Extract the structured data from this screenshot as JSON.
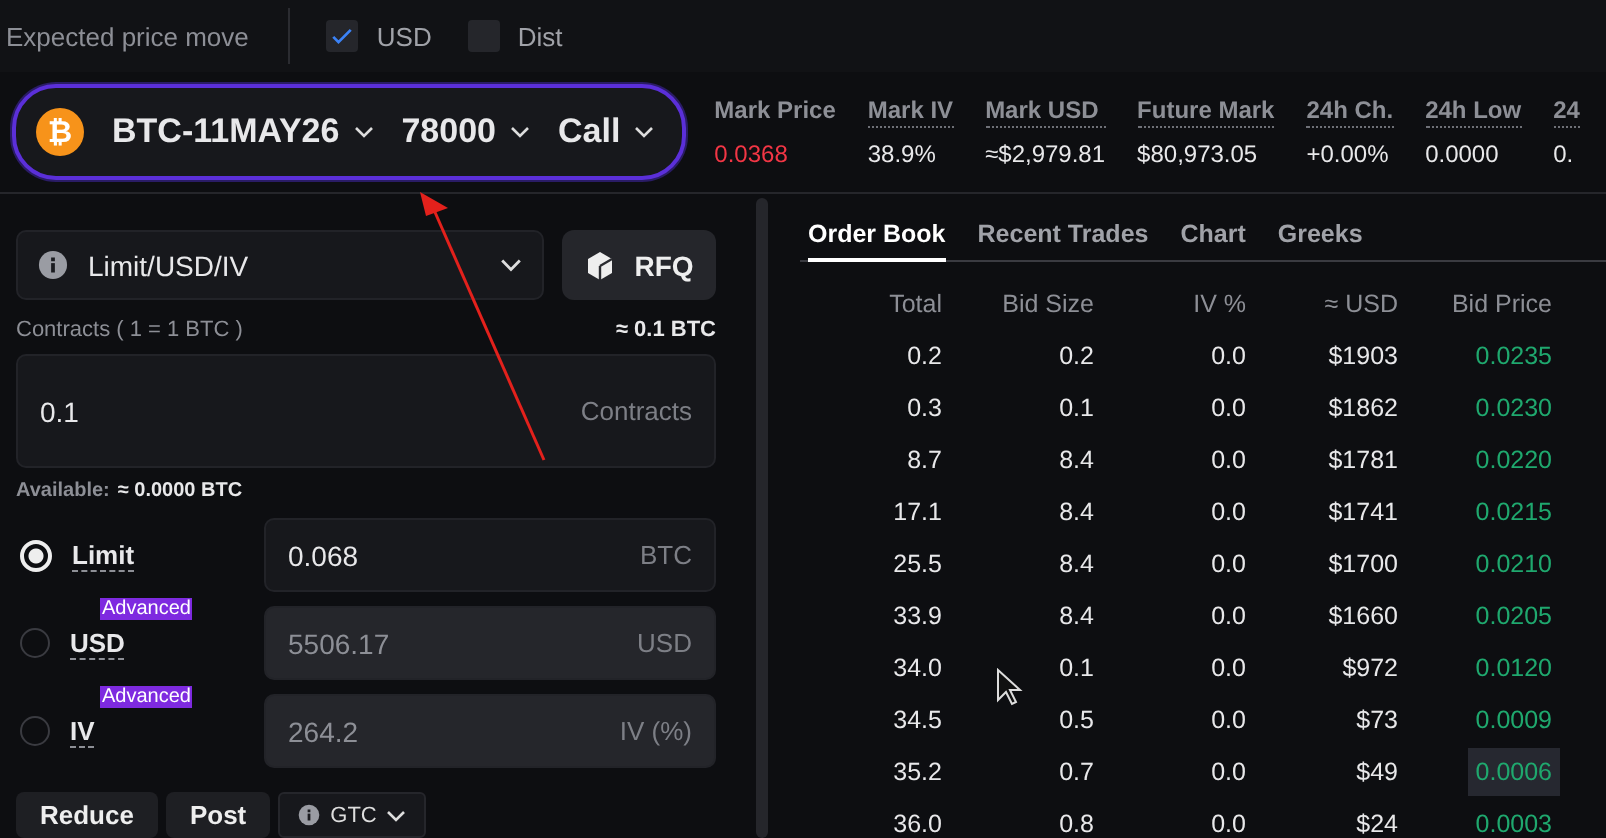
{
  "top_bar": {
    "label": "Expected price move",
    "checkboxes": [
      {
        "label": "USD",
        "checked": true
      },
      {
        "label": "Dist",
        "checked": false
      }
    ]
  },
  "instrument": {
    "icon_glyph": "₿",
    "parts": [
      "BTC-11MAY26",
      "78000",
      "Call"
    ]
  },
  "stats": [
    {
      "label": "Mark Price",
      "value": "0.0368",
      "color": "#f23645"
    },
    {
      "label": "Mark IV",
      "value": "38.9%",
      "color": "#e8e8ea"
    },
    {
      "label": "Mark USD",
      "value": "≈$2,979.81",
      "color": "#e8e8ea"
    },
    {
      "label": "Future Mark",
      "value": "$80,973.05",
      "color": "#e8e8ea"
    },
    {
      "label": "24h Ch.",
      "value": "+0.00%",
      "color": "#e8e8ea"
    },
    {
      "label": "24h Low",
      "value": "0.0000",
      "color": "#e8e8ea"
    },
    {
      "label": "24",
      "value": "0.",
      "color": "#e8e8ea"
    }
  ],
  "order_form": {
    "type_select": "Limit/USD/IV",
    "rfq_button": "RFQ",
    "contracts_label": "Contracts ( 1 = 1 BTC )",
    "contracts_estimate": "≈ 0.1 BTC",
    "contracts": {
      "value": "0.1",
      "unit": "Contracts"
    },
    "available_label": "Available:",
    "available_value": "≈ 0.0000 BTC",
    "price_modes": [
      {
        "label": "Limit",
        "selected": true,
        "value": "0.068",
        "unit": "BTC",
        "disabled": false
      },
      {
        "label": "USD",
        "badge": "Advanced",
        "selected": false,
        "value": "5506.17",
        "unit": "USD",
        "disabled": true
      },
      {
        "label": "IV",
        "badge": "Advanced",
        "selected": false,
        "value": "264.2",
        "unit": "IV (%)",
        "disabled": true
      }
    ],
    "options": [
      "Reduce",
      "Post"
    ],
    "time_in_force": "GTC"
  },
  "order_book": {
    "tabs": [
      {
        "label": "Order Book",
        "selected": true
      },
      {
        "label": "Recent Trades",
        "selected": false
      },
      {
        "label": "Chart",
        "selected": false
      },
      {
        "label": "Greeks",
        "selected": false
      }
    ],
    "columns": [
      "Total",
      "Bid Size",
      "IV %",
      "≈ USD",
      "Bid Price"
    ],
    "rows": [
      {
        "cells": [
          "0.2",
          "0.2",
          "0.0",
          "$1903",
          "0.0235"
        ],
        "highlighted": false
      },
      {
        "cells": [
          "0.3",
          "0.1",
          "0.0",
          "$1862",
          "0.0230"
        ],
        "highlighted": false
      },
      {
        "cells": [
          "8.7",
          "8.4",
          "0.0",
          "$1781",
          "0.0220"
        ],
        "highlighted": false
      },
      {
        "cells": [
          "17.1",
          "8.4",
          "0.0",
          "$1741",
          "0.0215"
        ],
        "highlighted": false
      },
      {
        "cells": [
          "25.5",
          "8.4",
          "0.0",
          "$1700",
          "0.0210"
        ],
        "highlighted": false
      },
      {
        "cells": [
          "33.9",
          "8.4",
          "0.0",
          "$1660",
          "0.0205"
        ],
        "highlighted": false
      },
      {
        "cells": [
          "34.0",
          "0.1",
          "0.0",
          "$972",
          "0.0120"
        ],
        "highlighted": false
      },
      {
        "cells": [
          "34.5",
          "0.5",
          "0.0",
          "$73",
          "0.0009"
        ],
        "highlighted": false
      },
      {
        "cells": [
          "35.2",
          "0.7",
          "0.0",
          "$49",
          "0.0006"
        ],
        "highlighted": true
      },
      {
        "cells": [
          "36.0",
          "0.8",
          "0.0",
          "$24",
          "0.0003"
        ],
        "highlighted": false
      }
    ]
  }
}
